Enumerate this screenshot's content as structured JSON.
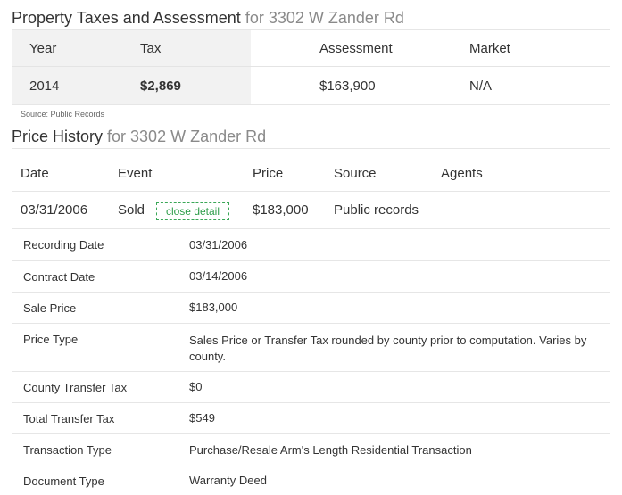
{
  "tax_section": {
    "title": "Property Taxes and Assessment",
    "subtitle": "for 3302 W Zander Rd",
    "columns": [
      "Year",
      "Tax",
      "Assessment",
      "Market"
    ],
    "row": [
      "2014",
      "$2,869",
      "$163,900",
      "N/A"
    ],
    "source_note": "Source: Public Records"
  },
  "price_section": {
    "title": "Price History",
    "subtitle": "for 3302 W Zander Rd",
    "columns": [
      "Date",
      "Event",
      "Price",
      "Source",
      "Agents"
    ],
    "row": {
      "date": "03/31/2006",
      "event": "Sold",
      "action_label": "close detail",
      "price": "$183,000",
      "source": "Public records",
      "agents": ""
    },
    "details": [
      {
        "label": "Recording Date",
        "value": "03/31/2006"
      },
      {
        "label": "Contract Date",
        "value": "03/14/2006"
      },
      {
        "label": "Sale Price",
        "value": "$183,000"
      },
      {
        "label": "Price Type",
        "value": "Sales Price or Transfer Tax rounded by county prior to computation. Varies by county."
      },
      {
        "label": "County Transfer Tax",
        "value": "$0"
      },
      {
        "label": "Total Transfer Tax",
        "value": "$549"
      },
      {
        "label": "Transaction Type",
        "value": "Purchase/Resale Arm's Length Residential Transaction"
      },
      {
        "label": "Document Type",
        "value": "Warranty Deed"
      }
    ]
  },
  "colors": {
    "accent_green": "#2e9d4a",
    "header_shade": "#f2f2f2",
    "subtitle_gray": "#8a8a8a"
  }
}
